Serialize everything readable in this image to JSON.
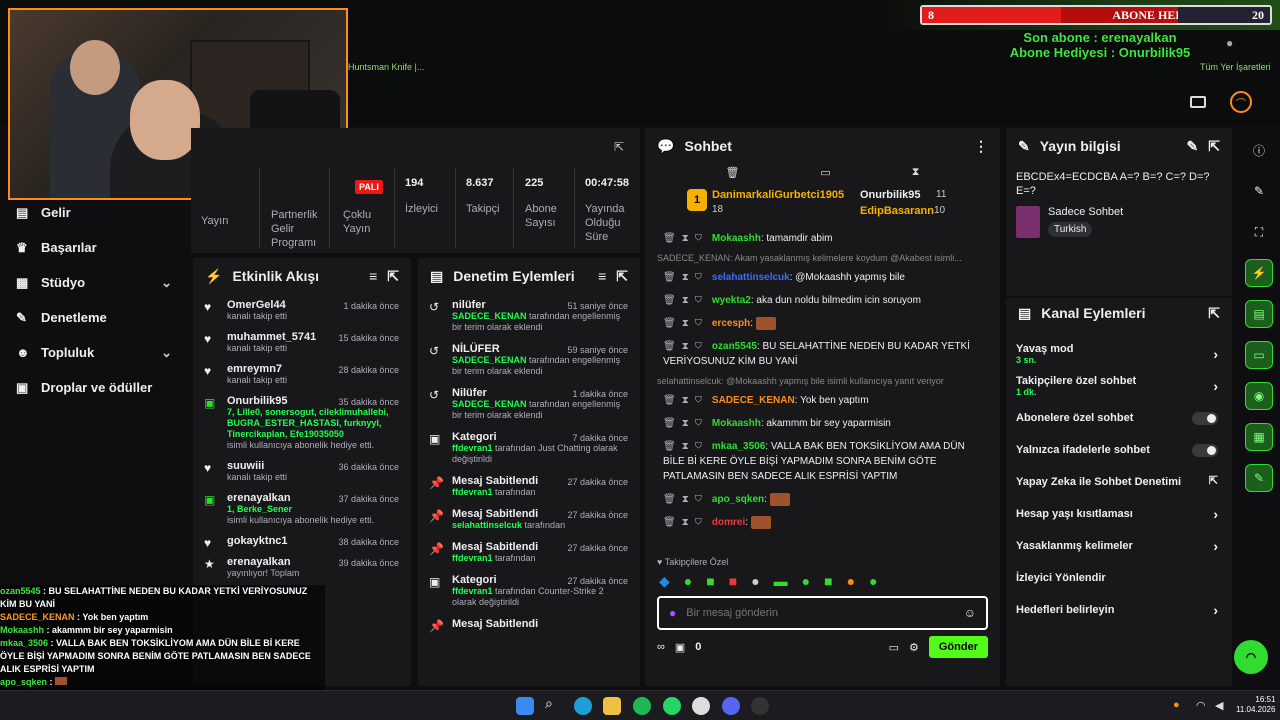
{
  "goal": {
    "left_value": "8",
    "title": "ABONE HEDEFİ",
    "target": "20"
  },
  "stream_overlay": {
    "last_sub": "Son abone : erenayalkan",
    "gift_sub": "Abone Hediyesi : Onurbilik95"
  },
  "bookmarks": {
    "item": "Huntsman Knife |...",
    "all": "Tüm Yer İşaretleri"
  },
  "stats": {
    "live_badge": "PALI",
    "items": [
      {
        "value": "",
        "label": "Yayın"
      },
      {
        "value": "",
        "label": "Partnerlik Gelir Programı"
      },
      {
        "value": "",
        "label": "Çoklu Yayın"
      },
      {
        "value": "194",
        "label": "İzleyici"
      },
      {
        "value": "8.637",
        "label": "Takipçi"
      },
      {
        "value": "225",
        "label": "Abone Sayısı"
      },
      {
        "value": "00:47:58",
        "label": "Yayında Olduğu Süre"
      }
    ]
  },
  "sidebar": {
    "items": [
      {
        "label": "Gelir",
        "icon": "money-icon"
      },
      {
        "label": "Başarılar",
        "icon": "trophy-icon"
      },
      {
        "label": "Stüdyo",
        "icon": "studio-icon",
        "expand": true
      },
      {
        "label": "Denetleme",
        "icon": "wrench-icon"
      },
      {
        "label": "Topluluk",
        "icon": "people-icon",
        "expand": true
      },
      {
        "label": "Droplar ve ödüller",
        "icon": "gift-icon"
      }
    ]
  },
  "activity": {
    "title": "Etkinlik Akışı",
    "events": [
      {
        "user": "OmerGel44",
        "time": "1 dakika önce",
        "desc": "kanalı takip etti",
        "icon": "heart"
      },
      {
        "user": "muhammet_5741",
        "time": "15 dakika önce",
        "desc": "kanalı takip etti",
        "icon": "heart"
      },
      {
        "user": "emreymn7",
        "time": "28 dakika önce",
        "desc": "kanalı takip etti",
        "icon": "heart"
      },
      {
        "user": "Onurbilik95",
        "time": "35 dakika önce",
        "gift": "7, Lille0, sonersogut, cileklimuhallebi, BUGRA_ESTER_HASTASI, furknyyl, Tinercikaplan, Efe19035050",
        "desc": "isimli kullanıcıya abonelik hediye etti.",
        "icon": "gift"
      },
      {
        "user": "suuwiii",
        "time": "36 dakika önce",
        "desc": "kanalı takip etti",
        "icon": "heart"
      },
      {
        "user": "erenayalkan",
        "time": "37 dakika önce",
        "gift": "1, Berke_Sener",
        "desc": "isimli kullanıcıya abonelik hediye etti.",
        "icon": "gift"
      },
      {
        "user": "gokayktnc1",
        "time": "38 dakika önce",
        "desc": "",
        "icon": "heart"
      },
      {
        "user": "erenayalkan",
        "time": "39 dakika önce",
        "desc": "yayınlıyor! Toplam",
        "icon": "star"
      }
    ]
  },
  "moderation": {
    "title": "Denetim Eylemleri",
    "events": [
      {
        "user": "nilüfer",
        "time": "51 saniye önce",
        "actor": "SADECE_KENAN",
        "desc": "tarafından engellenmiş bir terim olarak eklendi",
        "icon": "undo"
      },
      {
        "user": "NİLÜFER",
        "time": "59 saniye önce",
        "actor": "SADECE_KENAN",
        "desc": "tarafından engellenmiş bir terim olarak eklendi",
        "icon": "undo"
      },
      {
        "user": "Nilüfer",
        "time": "1 dakika önce",
        "actor": "SADECE_KENAN",
        "desc": "tarafından engellenmiş bir terim olarak eklendi",
        "icon": "undo"
      },
      {
        "user": "Kategori",
        "time": "7 dakika önce",
        "actor": "ffdevran1",
        "desc": "tarafından Just Chatting olarak değiştirildi",
        "icon": "category"
      },
      {
        "user": "Mesaj Sabitlendi",
        "time": "27 dakika önce",
        "actor": "ffdevran1",
        "desc": "tarafından",
        "icon": "pin"
      },
      {
        "user": "Mesaj Sabitlendi",
        "time": "27 dakika önce",
        "actor": "selahattinselcuk",
        "desc": "tarafından",
        "icon": "pin"
      },
      {
        "user": "Mesaj Sabitlendi",
        "time": "27 dakika önce",
        "actor": "ffdevran1",
        "desc": "tarafından",
        "icon": "pin"
      },
      {
        "user": "Kategori",
        "time": "27 dakika önce",
        "actor": "ffdevran1",
        "desc": "tarafından Counter-Strike 2 olarak değiştirildi",
        "icon": "category"
      },
      {
        "user": "Mesaj Sabitlendi",
        "time": "",
        "actor": "",
        "desc": "",
        "icon": "pin"
      }
    ]
  },
  "chat": {
    "title": "Sohbet",
    "top_gifters": [
      {
        "name": "DanimarkaliGurbetci1905",
        "count": "18"
      },
      {
        "name": "Onurbilik95",
        "count": "11"
      },
      {
        "name": "EdipBasarann",
        "count": "10"
      }
    ],
    "messages": [
      {
        "user": "Mokaashh",
        "color": "#2fdc2f",
        "text": "tamamdir abim",
        "reply": ""
      },
      {
        "user": "selahattinselcuk",
        "color": "#3b6bff",
        "text": "@Mokaashh yapmış bile",
        "reply": "SADECE_KENAN: Akam yasaklanmış kelimelere koydum @Akabest isimli..."
      },
      {
        "user": "wyekta2",
        "color": "#2fdc2f",
        "text": "aka dun noldu bilmedim icin soruyom",
        "reply": ""
      },
      {
        "user": "ercesph",
        "color": "#ff8c1a",
        "text": "",
        "reply": ""
      },
      {
        "user": "ozan5545",
        "color": "#2fdc2f",
        "text": "BU SELAHATTİNE NEDEN BU KADAR YETKİ VERİYOSUNUZ KİM BU YANİ",
        "reply": ""
      },
      {
        "user": "SADECE_KENAN",
        "color": "#ff8c1a",
        "text": "Yok ben yaptım",
        "reply": "selahattinselcuk: @Mokaashh yapmış bile isimli kullanıcıya yanıt veriyor"
      },
      {
        "user": "Mokaashh",
        "color": "#2fdc2f",
        "text": "akammm bir sey yaparmisin",
        "reply": ""
      },
      {
        "user": "mkaa_3506",
        "color": "#2fdc2f",
        "text": "VALLA BAK BEN TOKSİKLİYOM AMA DÜN BİLE Bİ KERE ÖYLE BİŞİ YAPMADIM SONRA BENİM GÖTE PATLAMASIN BEN SADECE ALIK ESPRİSİ YAPTIM",
        "reply": ""
      },
      {
        "user": "apo_sqken",
        "color": "#2fdc2f",
        "text": "",
        "reply": ""
      },
      {
        "user": "domrei",
        "color": "#e93c3c",
        "text": "",
        "reply": ""
      }
    ],
    "followers_only": "Takipçilere Özel",
    "input_placeholder": "Bir mesaj gönderin",
    "points": "0",
    "send_label": "Gönder"
  },
  "stream_info": {
    "title": "Yayın bilgisi",
    "stream_title": "EBCDEx4=ECDCBA A=? B=? C=? D=? E=?",
    "category": "Sadece Sohbet",
    "tag": "Turkish"
  },
  "channel_actions": {
    "title": "Kanal Eylemleri",
    "items": [
      {
        "label": "Yavaş mod",
        "sub": "3 sn.",
        "type": "chevron"
      },
      {
        "label": "Takipçilere özel sohbet",
        "sub": "1 dk.",
        "type": "chevron"
      },
      {
        "label": "Abonelere özel sohbet",
        "sub": "",
        "type": "toggle"
      },
      {
        "label": "Yalnızca ifadelerle sohbet",
        "sub": "",
        "type": "toggle"
      },
      {
        "label": "Yapay Zeka ile Sohbet Denetimi",
        "sub": "",
        "type": "external"
      },
      {
        "label": "Hesap yaşı kısıtlaması",
        "sub": "",
        "type": "chevron"
      },
      {
        "label": "Yasaklanmış kelimeler",
        "sub": "",
        "type": "chevron"
      },
      {
        "label": "İzleyici Yönlendir",
        "sub": "",
        "type": "none"
      },
      {
        "label": "Hedefleri belirleyin",
        "sub": "",
        "type": "chevron"
      }
    ]
  },
  "overlay_chat": [
    {
      "user": "ozan5545",
      "color": "#3fe63f",
      "text": "BU SELAHATTİNE NEDEN BU KADAR YETKİ VERİYOSUNUZ KİM BU YANİ"
    },
    {
      "user": "SADECE_KENAN",
      "color": "#ff9c2a",
      "text": "Yok ben yaptım"
    },
    {
      "user": "Mokaashh",
      "color": "#3fe63f",
      "text": "akammm bir sey yaparmisin"
    },
    {
      "user": "mkaa_3506",
      "color": "#3fe63f",
      "text": "VALLA BAK BEN TOKSİKLİYOM AMA DÜN BİLE Bİ KERE ÖYLE BİŞİ YAPMADIM SONRA BENİM GÖTE PATLAMASIN BEN SADECE ALIK ESPRİSİ YAPTIM"
    },
    {
      "user": "apo_sqken",
      "color": "#3fe63f",
      "text": ""
    },
    {
      "user": "domrei",
      "color": "#ff4d4d",
      "text": ""
    }
  ],
  "taskbar": {
    "time": "16:51",
    "date": "11.04.2026"
  }
}
